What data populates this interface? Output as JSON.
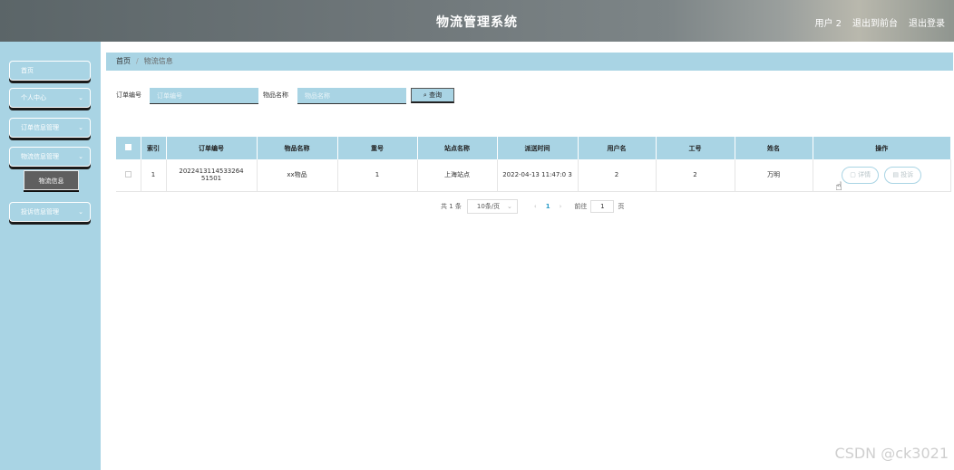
{
  "header": {
    "title": "物流管理系统",
    "user_label": "用户 2",
    "back_label": "退出到前台",
    "logout_label": "退出登录"
  },
  "sidebar": {
    "items": [
      {
        "label": "首页",
        "has_chevron": false
      },
      {
        "label": "个人中心",
        "has_chevron": true
      },
      {
        "label": "订单信息管理",
        "has_chevron": true
      },
      {
        "label": "物流信息管理",
        "has_chevron": true
      },
      {
        "label": "投诉信息管理",
        "has_chevron": true
      }
    ],
    "active_sub": "物流信息",
    "chevron_glyph": "⌄"
  },
  "breadcrumb": {
    "home": "首页",
    "separator": "/",
    "current": "物流信息"
  },
  "search": {
    "order_label": "订单编号",
    "order_placeholder": "订单编号",
    "goods_label": "物品名称",
    "goods_placeholder": "物品名称",
    "button_label": "查询",
    "button_icon": "search-icon"
  },
  "table": {
    "columns": [
      "",
      "索引",
      "订单编号",
      "物品名称",
      "重号",
      "站点名称",
      "派送时间",
      "用户名",
      "工号",
      "姓名",
      "操作"
    ],
    "rows": [
      {
        "index": "1",
        "order_no": "2022413114533264 51501",
        "goods": "xx物品",
        "num": "1",
        "station": "上海站点",
        "time": "2022-04-13 11:47:0 3",
        "username": "2",
        "worker_no": "2",
        "name": "万明",
        "detail_label": "详情",
        "complain_label": "投诉"
      }
    ]
  },
  "pagination": {
    "total": "共 1 条",
    "page_size": "10条/页",
    "prev": "‹",
    "current_page": "1",
    "next": "›",
    "goto_label": "前往",
    "goto_value": "1",
    "page_suffix": "页"
  },
  "watermark": "CSDN @ck3021",
  "colors": {
    "accent": "#a9d4e4",
    "active_sub": "#5f5f5f",
    "page_active": "#2c9dc8"
  }
}
